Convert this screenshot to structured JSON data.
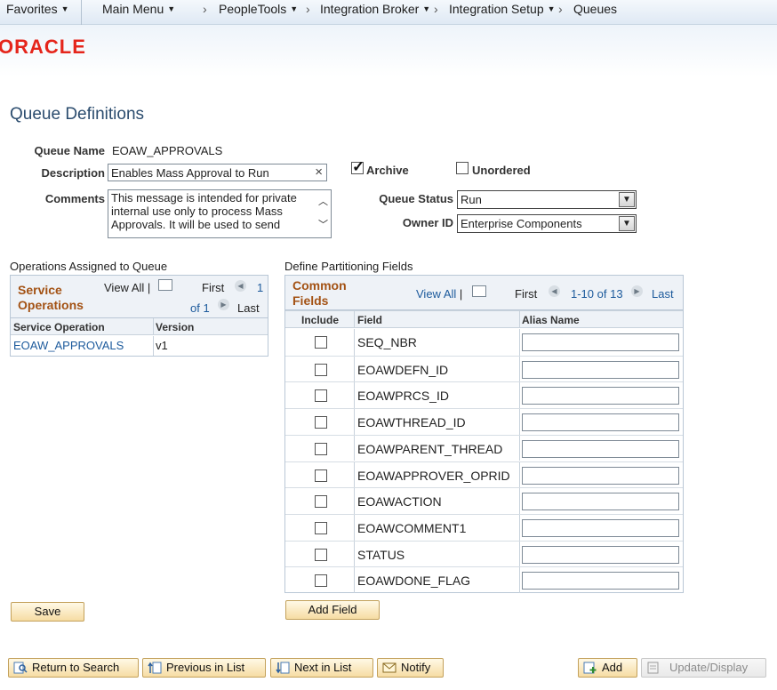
{
  "nav": {
    "favorites": "Favorites",
    "main_menu": "Main Menu",
    "breadcrumbs": [
      "PeopleTools",
      "Integration Broker",
      "Integration Setup",
      "Queues"
    ]
  },
  "brand": {
    "logo_text": "ORACLE",
    "logo_color": "#e5251b"
  },
  "page": {
    "title": "Queue Definitions"
  },
  "form": {
    "queue_name_label": "Queue Name",
    "queue_name_value": "EOAW_APPROVALS",
    "description_label": "Description",
    "description_value": "Enables Mass Approval to Run",
    "comments_label": "Comments",
    "comments_value": "This message is intended for private internal use only to process Mass Approvals.  It will be used to send",
    "archive_label": "Archive",
    "archive_checked": true,
    "unordered_label": "Unordered",
    "unordered_checked": false,
    "queue_status_label": "Queue Status",
    "queue_status_value": "Run",
    "owner_id_label": "Owner ID",
    "owner_id_value": "Enterprise Components"
  },
  "operations": {
    "section_label": "Operations Assigned to Queue",
    "grid_title_line1": "Service",
    "grid_title_line2": "Operations",
    "view_all": "View All",
    "first": "First",
    "page_num": "1",
    "of_text": "of 1",
    "last": "Last",
    "columns": [
      "Service Operation",
      "Version"
    ],
    "rows": [
      {
        "operation": "EOAW_APPROVALS",
        "version": "v1"
      }
    ]
  },
  "partitioning": {
    "section_label": "Define Partitioning Fields",
    "grid_title_line1": "Common",
    "grid_title_line2": "Fields",
    "view_all": "View All",
    "first": "First",
    "range": "1-10 of 13",
    "last": "Last",
    "columns": [
      "Include",
      "Field",
      "Alias Name"
    ],
    "rows": [
      {
        "field": "SEQ_NBR",
        "include": false,
        "alias": ""
      },
      {
        "field": "EOAWDEFN_ID",
        "include": false,
        "alias": ""
      },
      {
        "field": "EOAWPRCS_ID",
        "include": false,
        "alias": ""
      },
      {
        "field": "EOAWTHREAD_ID",
        "include": false,
        "alias": ""
      },
      {
        "field": "EOAWPARENT_THREAD",
        "include": false,
        "alias": ""
      },
      {
        "field": "EOAWAPPROVER_OPRID",
        "include": false,
        "alias": ""
      },
      {
        "field": "EOAWACTION",
        "include": false,
        "alias": ""
      },
      {
        "field": "EOAWCOMMENT1",
        "include": false,
        "alias": ""
      },
      {
        "field": "STATUS",
        "include": false,
        "alias": ""
      },
      {
        "field": "EOAWDONE_FLAG",
        "include": false,
        "alias": ""
      }
    ]
  },
  "buttons": {
    "save": "Save",
    "add_field": "Add Field",
    "return_to_search": "Return to Search",
    "previous_in_list": "Previous in List",
    "next_in_list": "Next in List",
    "notify": "Notify",
    "add": "Add",
    "update_display": "Update/Display"
  }
}
